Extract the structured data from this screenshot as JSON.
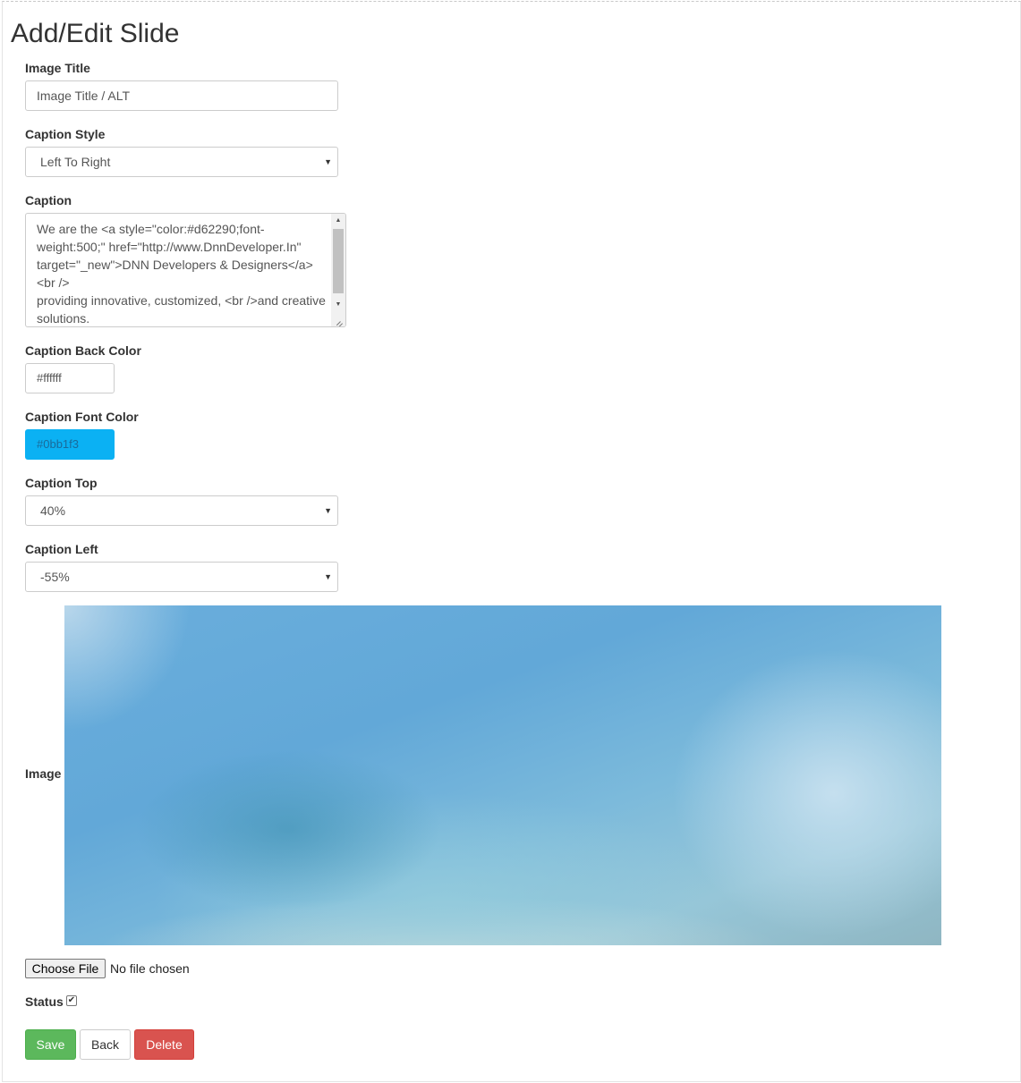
{
  "page": {
    "title": "Add/Edit Slide"
  },
  "fields": {
    "image_title": {
      "label": "Image Title",
      "placeholder": "Image Title / ALT",
      "value": ""
    },
    "caption_style": {
      "label": "Caption Style",
      "value": "Left To Right"
    },
    "caption": {
      "label": "Caption",
      "value": "We are the <a style=\"color:#d62290;font-weight:500;\" href=\"http://www.DnnDeveloper.In\" target=\"_new\">DNN Developers & Designers</a>\n<br />\nproviding innovative, customized, <br />and creative solutions."
    },
    "caption_back_color": {
      "label": "Caption Back Color",
      "value": "#ffffff"
    },
    "caption_font_color": {
      "label": "Caption Font Color",
      "value": "#0bb1f3"
    },
    "caption_top": {
      "label": "Caption Top",
      "value": "40%"
    },
    "caption_left": {
      "label": "Caption Left",
      "value": "-55%"
    },
    "image": {
      "label": "Image"
    },
    "file": {
      "button_label": "Choose File",
      "status_text": "No file chosen"
    },
    "status": {
      "label": "Status",
      "checked": true
    }
  },
  "actions": {
    "save_label": "Save",
    "back_label": "Back",
    "delete_label": "Delete"
  },
  "colors": {
    "save": "#5cb85c",
    "delete": "#d9534f",
    "font_color_swatch": "#0bb1f3"
  },
  "icons": {
    "select_arrow": "chevron-down-icon",
    "checkbox": "checkmark-icon"
  }
}
